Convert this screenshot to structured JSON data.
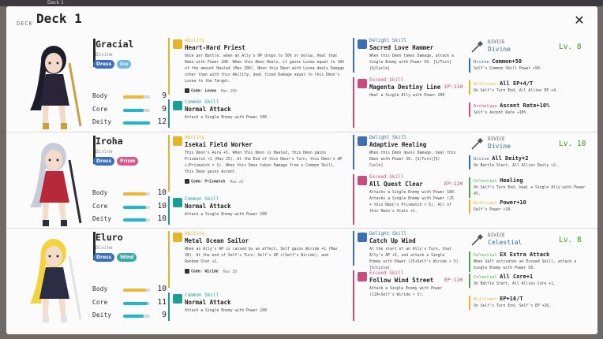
{
  "window": {
    "tab_title": "Deck 1"
  },
  "deck": {
    "label": "DECK",
    "title": "Deck 1",
    "close_label": "✕"
  },
  "characters": [
    {
      "name": "Gracial",
      "class": "Divine",
      "tags": [
        "Dress",
        "Ice"
      ],
      "stats": [
        {
          "label": "Body",
          "value": 9,
          "fill": 0.75
        },
        {
          "label": "Core",
          "value": 9,
          "fill": 0.75
        },
        {
          "label": "Deity",
          "value": 12,
          "fill": 1.0
        }
      ],
      "skills": [
        {
          "type": "Ability",
          "name": "Heart-Hard Priest",
          "desc": [
            "Once per Battle, when an Ally's HP drops to 50% or below, Heal that",
            "Dmon with Power 200. When this Dmon Heals, it gains Lovea equal to 10%",
            "of the amount Healed (Max 200). When this Dmon with Lovea deals Damage",
            "other than with this Ability, deal fixed Damage equal to this Dmon's",
            "Lovea to the Target."
          ],
          "code": "Code: Lovea",
          "code_max": "Max 200"
        },
        {
          "type": "Common Skill",
          "name": "Normal Attack",
          "desc": [
            "Attack a Single Enemy with Power 100"
          ]
        },
        {
          "type": "Delight Skill",
          "name": "Sacred Love Hammer",
          "desc": [
            "When this Dmon takes Damage, attack a",
            "Single Enemy with Power 50. [2/Turn]",
            "[4/Cycle]"
          ]
        },
        {
          "type": "Exceed Skill",
          "name": "Magenta Destiny Line",
          "ep": "EP:110",
          "desc": [
            "Heal a Single Ally with Power 200"
          ]
        }
      ],
      "divinity": {
        "label": "DIVICE",
        "name": "Divine",
        "level": "Lv. 8",
        "items": [
          {
            "kind": "Divine",
            "title": "Common+50",
            "desc": [
              "Self's Common Skill Power +50."
            ]
          },
          {
            "kind": "Brilliant",
            "title": "All EP+4/T",
            "desc": [
              "On Self's Turn End, All Allies EP +4."
            ]
          },
          {
            "kind": "Archetype",
            "title": "Ascent Rate+10%",
            "desc": [
              "Self's Ascent Rate +10%."
            ]
          }
        ]
      }
    },
    {
      "name": "Iroha",
      "class": "Divine",
      "tags": [
        "Dress",
        "Prism"
      ],
      "stats": [
        {
          "label": "Body",
          "value": 10,
          "fill": 0.85
        },
        {
          "label": "Core",
          "value": 10,
          "fill": 0.85
        },
        {
          "label": "Deity",
          "value": 10,
          "fill": 0.85
        }
      ],
      "skills": [
        {
          "type": "Ability",
          "name": "Isekai Field Worker",
          "desc": [
            "This Dmon's Aura +5. When this Dmon is Healed, this Dmon gains",
            "Prismatch +1 (Max 25). At the End of this Dmon's Turn, this Dmon's AP",
            "+(Prismatch × 1). When this Dmon takes Damage from a Common Skill,",
            "this Dmon gains Ascent."
          ],
          "code": "Code: Prismatch",
          "code_max": "Max 25"
        },
        {
          "type": "Common Skill",
          "name": "Normal Attack",
          "desc": [
            "Attack a Single Enemy with Power 100"
          ]
        },
        {
          "type": "Delight Skill",
          "name": "Adaptive Healing",
          "desc": [
            "When this Dmon deals Damage, heal this",
            "Dmon with Power 30. [3/Turn][5/",
            "Cycle]"
          ]
        },
        {
          "type": "Exceed Skill",
          "name": "All Quest Clear",
          "ep": "EP:120",
          "desc": [
            "Attacks a Single Enemy with Power 100.",
            "Attacks a Single Enemy with Power (25",
            "+ this Dmon's Prismatch × 5). All of",
            "this Dmon's Stats +1."
          ]
        }
      ],
      "divinity": {
        "label": "DIVICE",
        "name": "Divine",
        "level": "Lv. 10",
        "items": [
          {
            "kind": "Divine",
            "title": "All Deity+2",
            "desc": [
              "On Battle Start, All Allies Deity +2."
            ]
          },
          {
            "kind": "Celestial",
            "title": "Healing",
            "desc": [
              "On Self's Turn End, heal a Single Ally with Power",
              "45."
            ]
          },
          {
            "kind": "Brilliant",
            "title": "Power+10",
            "desc": [
              "Self's Power +10."
            ]
          }
        ]
      }
    },
    {
      "name": "Eluro",
      "class": "Divine",
      "tags": [
        "Dress",
        "Wind"
      ],
      "stats": [
        {
          "label": "Body",
          "value": 10,
          "fill": 0.85
        },
        {
          "label": "Core",
          "value": 11,
          "fill": 0.92
        },
        {
          "label": "Deity",
          "value": 9,
          "fill": 0.75
        }
      ],
      "skills": [
        {
          "type": "Ability",
          "name": "Metal Ocean Sailor",
          "desc": [
            "When an Ally's AP is raised by an effect, Self gains Wiride +1 (Max",
            "30). At the end of Self's Turn, Self's AP +(Self's Wiride), and",
            "Random Stat +1."
          ],
          "code": "Code: Wiride",
          "code_max": "Max 30"
        },
        {
          "type": "Common Skill",
          "name": "Normal Attack",
          "desc": [
            "Attack a Single Enemy with Power 100"
          ]
        },
        {
          "type": "Delight Skill",
          "name": "Catch Up Wind",
          "desc": [
            "At the start of an Ally's Turn, that",
            "Ally's AP +5, and attack a Single",
            "Enemy with Power (25+Self's Wiride × 5).",
            "[5/Cycle]"
          ]
        },
        {
          "type": "Exceed Skill",
          "name": "Follow Wind Street",
          "ep": "EP:120",
          "desc": [
            "Attack a Single Enemy with Power",
            "(110+Self's Wiride × 5)."
          ]
        }
      ],
      "divinity": {
        "label": "DIVICE",
        "name": "Celestial",
        "level": "Lv. 8",
        "items": [
          {
            "kind": "Celestial",
            "title": "EX Extra Attack",
            "desc": [
              "When Self activates an Exceed Skill, attack a",
              "Single Enemy with Power 50."
            ]
          },
          {
            "kind": "Celestial",
            "title": "All Core+1",
            "desc": [
              "On Battle Start, All Allies Core +1."
            ]
          },
          {
            "kind": "Brilliant",
            "title": "EP+16/T",
            "desc": [
              "On Self's Turn End, Self's EP +16."
            ]
          }
        ]
      }
    }
  ],
  "colors": {
    "ability": "#e3b52a",
    "common": "#1a9e95",
    "delight": "#3d6fb6",
    "exceed": "#c94d7c",
    "stat_bar": "#e9b838",
    "stat_bar2": "#22b6c7",
    "divine": "#2a6fa8",
    "brilliant": "#e3b52a",
    "archetype": "#c94d7c",
    "celestial": "#4fa34e"
  }
}
